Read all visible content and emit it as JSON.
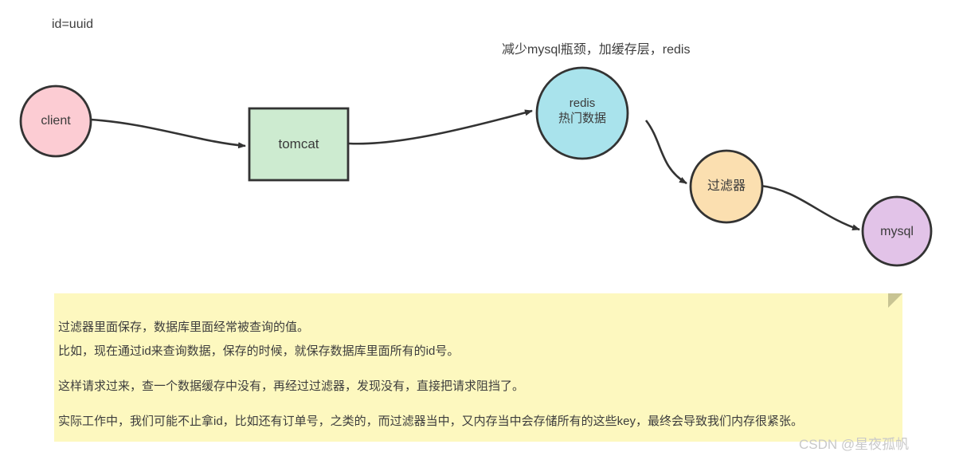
{
  "diagram": {
    "annotations": [
      {
        "id": "id-uuid",
        "text": "id=uuid"
      },
      {
        "id": "redis-note",
        "text": "减少mysql瓶颈，加缓存层，redis"
      }
    ],
    "nodes": [
      {
        "id": "client",
        "label": "client",
        "shape": "circle",
        "fill": "#fcccd3",
        "stroke": "#333333"
      },
      {
        "id": "tomcat",
        "label": "tomcat",
        "shape": "rect",
        "fill": "#cdebd0",
        "stroke": "#333333"
      },
      {
        "id": "redis",
        "label_line1": "redis",
        "label_line2": "热门数据",
        "shape": "circle",
        "fill": "#a9e3ec",
        "stroke": "#333333"
      },
      {
        "id": "filter",
        "label": "过滤器",
        "shape": "circle",
        "fill": "#fbdfb0",
        "stroke": "#333333"
      },
      {
        "id": "mysql",
        "label": "mysql",
        "shape": "circle",
        "fill": "#e2c3e8",
        "stroke": "#333333"
      }
    ],
    "edges": [
      {
        "from": "client",
        "to": "tomcat"
      },
      {
        "from": "tomcat",
        "to": "redis"
      },
      {
        "from": "redis",
        "to": "filter"
      },
      {
        "from": "filter",
        "to": "mysql"
      }
    ]
  },
  "note": {
    "background": "#fdf8bf",
    "fold_color": "#c8c493",
    "lines": [
      "过滤器里面保存，数据库里面经常被查询的值。",
      "比如，现在通过id来查询数据，保存的时候，就保存数据库里面所有的id号。",
      "",
      "这样请求过来，查一个数据缓存中没有，再经过过滤器，发现没有，直接把请求阻挡了。",
      "",
      "实际工作中，我们可能不止拿id，比如还有订单号，之类的，而过滤器当中，又内存当中会存储所有的这些key，最终会导致我们内存很紧张。"
    ]
  },
  "watermark": {
    "text": "CSDN @星夜孤帆",
    "color": "#c9c9c9"
  }
}
